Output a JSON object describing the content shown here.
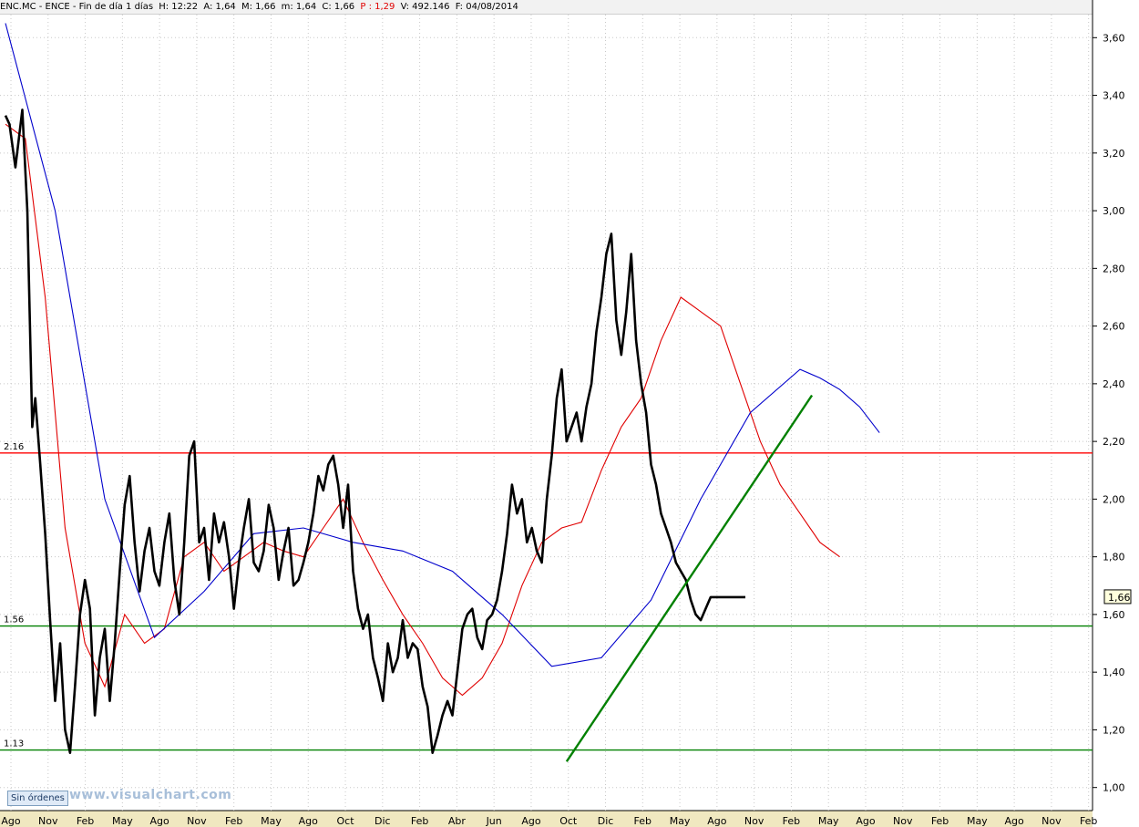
{
  "header": {
    "symbol": "ENC.MC - ENCE - Fin de día 1 días",
    "h": "H: 12:22",
    "a": "A: 1,64",
    "m": "M: 1,66",
    "mn": "m: 1,64",
    "c": "C: 1,66",
    "p": "P : 1,29",
    "v": "V: 492.146",
    "f": "F: 04/08/2014",
    "close_box": "×"
  },
  "footer": {
    "status_button": "Sin órdenes",
    "watermark": "www.visualchart.com"
  },
  "chart_data": {
    "type": "line",
    "y_range": [
      0.92,
      3.68
    ],
    "y_ticks": [
      "1,00",
      "1,20",
      "1,40",
      "1,60",
      "1,80",
      "2,00",
      "2,20",
      "2,40",
      "2,60",
      "2,80",
      "3,00",
      "3,20",
      "3,40",
      "3,60"
    ],
    "x_ticks": [
      "Ago",
      "Nov",
      "Feb",
      "May",
      "Ago",
      "Nov",
      "Feb",
      "May",
      "Ago",
      "Oct",
      "Dic",
      "Feb",
      "Abr",
      "Jun",
      "Ago",
      "Oct",
      "Dic",
      "Feb",
      "May",
      "Ago",
      "Nov",
      "Feb",
      "May",
      "Ago",
      "Nov",
      "Feb",
      "May",
      "Ago",
      "Nov",
      "Feb"
    ],
    "current_value": "1,66",
    "horizontal_levels": [
      {
        "label": "2.16",
        "value": 2.16,
        "color": "#ff0000"
      },
      {
        "label": "1.56",
        "value": 1.56,
        "color": "#008000"
      },
      {
        "label": "1.13",
        "value": 1.13,
        "color": "#008000"
      }
    ],
    "trendline": {
      "color": "#008000",
      "from": [
        0.565,
        1.09
      ],
      "to": [
        0.812,
        2.36
      ]
    },
    "price_series": {
      "color": "#000000",
      "t": [
        0,
        0.004,
        0.01,
        0.017,
        0.022,
        0.027,
        0.03,
        0.035,
        0.04,
        0.045,
        0.05,
        0.055,
        0.06,
        0.065,
        0.07,
        0.075,
        0.08,
        0.085,
        0.09,
        0.095,
        0.1,
        0.105,
        0.11,
        0.115,
        0.12,
        0.125,
        0.13,
        0.135,
        0.14,
        0.145,
        0.15,
        0.155,
        0.16,
        0.165,
        0.17,
        0.175,
        0.18,
        0.185,
        0.19,
        0.195,
        0.2,
        0.205,
        0.21,
        0.215,
        0.22,
        0.225,
        0.23,
        0.235,
        0.24,
        0.245,
        0.25,
        0.255,
        0.26,
        0.265,
        0.27,
        0.275,
        0.28,
        0.285,
        0.29,
        0.295,
        0.3,
        0.305,
        0.31,
        0.315,
        0.32,
        0.325,
        0.33,
        0.335,
        0.34,
        0.345,
        0.35,
        0.355,
        0.36,
        0.365,
        0.37,
        0.375,
        0.38,
        0.385,
        0.39,
        0.395,
        0.4,
        0.405,
        0.41,
        0.415,
        0.42,
        0.425,
        0.43,
        0.435,
        0.44,
        0.445,
        0.45,
        0.455,
        0.46,
        0.465,
        0.47,
        0.475,
        0.48,
        0.485,
        0.49,
        0.495,
        0.5,
        0.505,
        0.51,
        0.515,
        0.52,
        0.525,
        0.53,
        0.535,
        0.54,
        0.545,
        0.55,
        0.555,
        0.56,
        0.565,
        0.57,
        0.575,
        0.58,
        0.585,
        0.59,
        0.595,
        0.6,
        0.605,
        0.61,
        0.615,
        0.62,
        0.625,
        0.63,
        0.635,
        0.64,
        0.645,
        0.65,
        0.655,
        0.66,
        0.665,
        0.67,
        0.675,
        0.68,
        0.685,
        0.69,
        0.695,
        0.7,
        0.705,
        0.71,
        0.715,
        0.72,
        0.725,
        0.73,
        0.735,
        0.74,
        0.745,
        0.75,
        0.755,
        0.76,
        0.765,
        0.77,
        0.775,
        0.78,
        0.785,
        0.79,
        0.795,
        0.8,
        0.805,
        0.81,
        0.815,
        0.82,
        0.825,
        0.83,
        0.835,
        0.84,
        0.845,
        0.85,
        0.855,
        0.86,
        0.865,
        0.87,
        0.875,
        0.88,
        0.885,
        0.89,
        0.895,
        0.9,
        0.905,
        0.91,
        0.915,
        0.92
      ],
      "close": [
        3.33,
        3.3,
        3.15,
        3.35,
        3.0,
        2.25,
        2.35,
        2.12,
        1.88,
        1.58,
        1.3,
        1.5,
        1.2,
        1.12,
        1.35,
        1.6,
        1.72,
        1.62,
        1.25,
        1.45,
        1.55,
        1.3,
        1.5,
        1.75,
        1.98,
        2.08,
        1.85,
        1.68,
        1.82,
        1.9,
        1.75,
        1.7,
        1.85,
        1.95,
        1.72,
        1.6,
        1.85,
        2.15,
        2.2,
        1.85,
        1.9,
        1.72,
        1.95,
        1.85,
        1.92,
        1.8,
        1.62,
        1.78,
        1.9,
        2.0,
        1.78,
        1.75,
        1.82,
        1.98,
        1.9,
        1.72,
        1.82,
        1.9,
        1.7,
        1.72,
        1.78,
        1.85,
        1.95,
        2.08,
        2.03,
        2.12,
        2.15,
        2.05,
        1.9,
        2.05,
        1.75,
        1.62,
        1.55,
        1.6,
        1.45,
        1.38,
        1.3,
        1.5,
        1.4,
        1.45,
        1.58,
        1.45,
        1.5,
        1.48,
        1.35,
        1.28,
        1.12,
        1.18,
        1.25,
        1.3,
        1.25,
        1.4,
        1.55,
        1.6,
        1.62,
        1.52,
        1.48,
        1.58,
        1.6,
        1.65,
        1.75,
        1.88,
        2.05,
        1.95,
        2.0,
        1.85,
        1.9,
        1.82,
        1.78,
        2.0,
        2.15,
        2.35,
        2.45,
        2.2,
        2.25,
        2.3,
        2.2,
        2.32,
        2.4,
        2.58,
        2.7,
        2.85,
        2.92,
        2.62,
        2.5,
        2.65,
        2.85,
        2.55,
        2.4,
        2.3,
        2.12,
        2.05,
        1.95,
        1.9,
        1.85,
        1.78,
        1.75,
        1.72,
        1.65,
        1.6,
        1.58,
        1.62,
        1.66,
        1.66,
        1.66,
        1.66,
        1.66,
        1.66,
        1.66,
        1.66,
        1.66,
        1.66,
        1.66,
        1.66,
        1.66,
        1.66,
        1.66,
        1.66,
        1.66,
        1.66,
        1.66,
        1.66,
        1.66,
        1.66,
        1.66,
        1.66,
        1.66,
        1.66,
        1.66,
        1.66,
        1.66,
        1.66,
        1.66,
        1.66,
        1.66,
        1.66,
        1.66,
        1.66
      ]
    },
    "moving_averages": [
      {
        "color": "#e00000",
        "t": [
          0,
          0.02,
          0.04,
          0.06,
          0.08,
          0.1,
          0.12,
          0.14,
          0.16,
          0.18,
          0.2,
          0.22,
          0.24,
          0.26,
          0.28,
          0.3,
          0.32,
          0.34,
          0.36,
          0.38,
          0.4,
          0.42,
          0.44,
          0.46,
          0.48,
          0.5,
          0.52,
          0.54,
          0.56,
          0.58,
          0.6,
          0.62,
          0.64,
          0.66,
          0.68,
          0.7,
          0.72,
          0.74,
          0.76,
          0.78,
          0.8,
          0.82,
          0.84,
          0.86,
          0.88
        ],
        "values": [
          3.3,
          3.25,
          2.7,
          1.9,
          1.5,
          1.35,
          1.6,
          1.5,
          1.55,
          1.8,
          1.85,
          1.75,
          1.8,
          1.85,
          1.82,
          1.8,
          1.9,
          2.0,
          1.85,
          1.72,
          1.6,
          1.5,
          1.38,
          1.32,
          1.38,
          1.5,
          1.7,
          1.85,
          1.9,
          1.92,
          2.1,
          2.25,
          2.35,
          2.55,
          2.7,
          2.65,
          2.6,
          2.4,
          2.2,
          2.05,
          1.95,
          1.85,
          1.8
        ]
      },
      {
        "color": "#0000cc",
        "t": [
          0,
          0.05,
          0.1,
          0.15,
          0.2,
          0.25,
          0.3,
          0.35,
          0.4,
          0.45,
          0.5,
          0.55,
          0.6,
          0.65,
          0.7,
          0.75,
          0.8,
          0.82,
          0.84,
          0.86,
          0.88
        ],
        "values": [
          3.65,
          3.0,
          2.0,
          1.52,
          1.68,
          1.88,
          1.9,
          1.85,
          1.82,
          1.75,
          1.6,
          1.42,
          1.45,
          1.65,
          2.0,
          2.3,
          2.45,
          2.42,
          2.38,
          2.32,
          2.23
        ]
      }
    ]
  }
}
